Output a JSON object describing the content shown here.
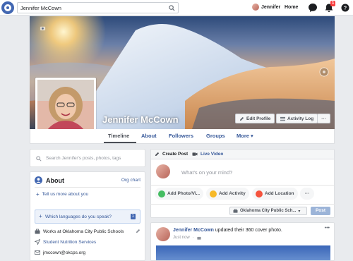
{
  "topbar": {
    "search_value": "Jennifer McCown",
    "user_name": "Jennifer",
    "home_label": "Home",
    "notification_count": "1"
  },
  "profile": {
    "name": "Jennifer McCown",
    "edit_profile": "Edit Profile",
    "activity_log": "Activity Log",
    "more_dots": "···"
  },
  "tabs": {
    "timeline": "Timeline",
    "about": "About",
    "followers": "Followers",
    "groups": "Groups",
    "more": "More ▾"
  },
  "left": {
    "search_placeholder": "Search Jennifer's posts, photos, tags",
    "about_title": "About",
    "org_chart": "Org chart",
    "tell_us": "Tell us more about you",
    "languages": "Which languages do you speak?",
    "languages_badge": "1",
    "works_at": "Works at Oklahoma City Public Schools",
    "student_nutrition": "Student Nutrition Services",
    "email": "jmccown@okcps.org"
  },
  "composer": {
    "create_post": "Create Post",
    "live_video": "Live Video",
    "placeholder": "What's on your mind?",
    "add_photo": "Add Photo/Vi...",
    "add_activity": "Add Activity",
    "add_location": "Add Location",
    "more_dots": "···",
    "audience": "Oklahoma City Public Sch...",
    "post": "Post"
  },
  "feed_post": {
    "author": "Jennifer McCown",
    "action": " updated their 360 cover photo.",
    "time": "Just now",
    "more_dots": "•••"
  },
  "colors": {
    "brand": "#4267b2",
    "link": "#365899",
    "badge": "#fa3e3e"
  }
}
